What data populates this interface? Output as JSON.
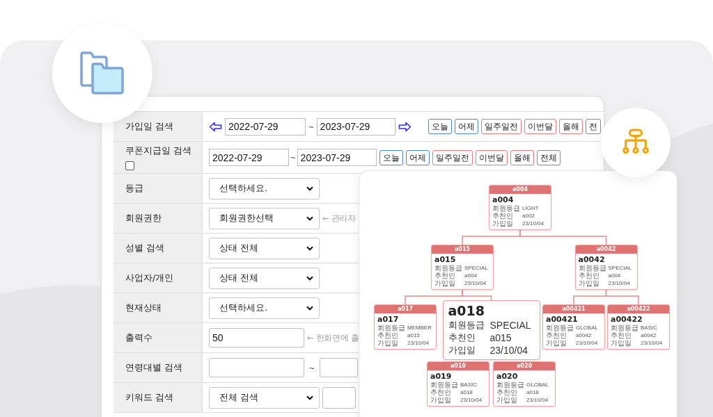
{
  "form": {
    "rows": [
      {
        "kind": "date_nav",
        "label": "가입일 검색",
        "from": "2022-07-29",
        "separator": "~",
        "to": "2023-07-29",
        "buttons": [
          {
            "label": "오늘",
            "color": "#4f86d4"
          },
          {
            "label": "어제",
            "color": "#4f86d4"
          },
          {
            "label": "일주일전",
            "color": "#e87b7b"
          },
          {
            "label": "이번달",
            "color": "#e87b7b"
          },
          {
            "label": "올해",
            "color": "#e87b7b"
          },
          {
            "label": "전",
            "color": "#8a8a8a"
          }
        ]
      },
      {
        "kind": "date",
        "label": "쿠폰지급일 검색",
        "checkbox": {
          "checked": false
        },
        "from": "2022-07-29",
        "separator": "~",
        "to": "2023-07-29",
        "buttons": [
          {
            "label": "오늘",
            "color": "#4f86d4"
          },
          {
            "label": "어제",
            "color": "#4f86d4"
          },
          {
            "label": "일주일전",
            "color": "#e87b7b"
          },
          {
            "label": "이번달",
            "color": "#e87b7b"
          },
          {
            "label": "올해",
            "color": "#e87b7b"
          },
          {
            "label": "전체",
            "color": "#8a8a8a"
          }
        ]
      },
      {
        "kind": "select",
        "label": "등급",
        "value": "선택하세요."
      },
      {
        "kind": "select",
        "label": "회원권한",
        "value": "회원권한선택",
        "hint": "← 관리자"
      },
      {
        "kind": "select",
        "label": "성별 검색",
        "value": "상태 전체"
      },
      {
        "kind": "select",
        "label": "사업자/개인",
        "value": "상태 전체"
      },
      {
        "kind": "select",
        "label": "현재상태",
        "value": "선택하세요."
      },
      {
        "kind": "input",
        "label": "출력수",
        "value": "50",
        "hint": "← 한화면에 출"
      },
      {
        "kind": "range",
        "label": "연령대별 검색",
        "separator": "~"
      },
      {
        "kind": "search",
        "label": "키워드 검색",
        "value": "전체 검색"
      }
    ]
  },
  "org_chart": {
    "root": {
      "header": "a004",
      "title": "a004",
      "enlarged": false,
      "fields": [
        {
          "label": "회원등급",
          "value": "LIGHT"
        },
        {
          "label": "추천인",
          "value": "a002"
        },
        {
          "label": "가입일",
          "value": "23/10/04"
        }
      ],
      "children": [
        {
          "header": "a015",
          "title": "a015",
          "enlarged": false,
          "fields": [
            {
              "label": "회원등급",
              "value": "SPECIAL"
            },
            {
              "label": "추천인",
              "value": "a004"
            },
            {
              "label": "가입일",
              "value": "23/10/04"
            }
          ],
          "children": [
            {
              "header": "a017",
              "title": "a017",
              "enlarged": false,
              "fields": [
                {
                  "label": "회원등급",
                  "value": "MEMBER"
                },
                {
                  "label": "추천인",
                  "value": "a015"
                },
                {
                  "label": "가입일",
                  "value": "23/10/04"
                }
              ]
            },
            {
              "title": "a018",
              "enlarged": true,
              "fields": [
                {
                  "label": "회원등급",
                  "value": "SPECIAL"
                },
                {
                  "label": "추천인",
                  "value": "a015"
                },
                {
                  "label": "가입일",
                  "value": "23/10/04"
                }
              ],
              "children": [
                {
                  "header": "a019",
                  "title": "a019",
                  "enlarged": false,
                  "fields": [
                    {
                      "label": "회원등급",
                      "value": "BASIC"
                    },
                    {
                      "label": "추천인",
                      "value": "a018"
                    },
                    {
                      "label": "가입일",
                      "value": "23/10/04"
                    }
                  ]
                },
                {
                  "header": "a020",
                  "title": "a020",
                  "enlarged": false,
                  "fields": [
                    {
                      "label": "회원등급",
                      "value": "GLOBAL"
                    },
                    {
                      "label": "추천인",
                      "value": "a018"
                    },
                    {
                      "label": "가입일",
                      "value": "23/10/04"
                    }
                  ]
                }
              ]
            }
          ]
        },
        {
          "header": "a0042",
          "title": "a0042",
          "enlarged": false,
          "fields": [
            {
              "label": "회원등급",
              "value": "SPECIAL"
            },
            {
              "label": "추천인",
              "value": "a004"
            },
            {
              "label": "가입일",
              "value": "23/10/04"
            }
          ],
          "children": [
            {
              "header": "a00421",
              "title": "a00421",
              "enlarged": false,
              "fields": [
                {
                  "label": "회원등급",
                  "value": "GLOBAL"
                },
                {
                  "label": "추천인",
                  "value": "a0042"
                },
                {
                  "label": "가입일",
                  "value": "23/10/04"
                }
              ]
            },
            {
              "header": "a00422",
              "title": "a00422",
              "enlarged": false,
              "fields": [
                {
                  "label": "회원등급",
                  "value": "BASIC"
                },
                {
                  "label": "추천인",
                  "value": "a0042"
                },
                {
                  "label": "가입일",
                  "value": "23/10/04"
                }
              ]
            }
          ]
        }
      ]
    }
  }
}
